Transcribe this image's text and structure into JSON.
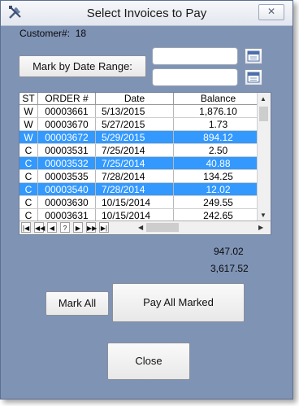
{
  "window": {
    "title": "Select Invoices to Pay",
    "close_glyph": "✕",
    "icon": "tools-icon"
  },
  "customer": {
    "label": "Customer#:",
    "number": "18"
  },
  "date_range": {
    "button_label": "Mark by Date Range:",
    "from_value": "",
    "to_value": "",
    "calendar_icon": "calendar-icon"
  },
  "grid": {
    "headers": [
      "ST",
      "ORDER #",
      "Date",
      "Balance"
    ],
    "rows": [
      {
        "st": "W",
        "order": "00003661",
        "date": "5/13/2015",
        "balance": "1,876.10",
        "selected": false
      },
      {
        "st": "W",
        "order": "00003670",
        "date": "5/27/2015",
        "balance": "1.73",
        "selected": false
      },
      {
        "st": "W",
        "order": "00003672",
        "date": "5/29/2015",
        "balance": "894.12",
        "selected": true
      },
      {
        "st": "C",
        "order": "00003531",
        "date": "7/25/2014",
        "balance": "2.50",
        "selected": false
      },
      {
        "st": "C",
        "order": "00003532",
        "date": "7/25/2014",
        "balance": "40.88",
        "selected": true
      },
      {
        "st": "C",
        "order": "00003535",
        "date": "7/28/2014",
        "balance": "134.25",
        "selected": false
      },
      {
        "st": "C",
        "order": "00003540",
        "date": "7/28/2014",
        "balance": "12.02",
        "selected": true
      },
      {
        "st": "C",
        "order": "00003630",
        "date": "10/15/2014",
        "balance": "249.55",
        "selected": false
      },
      {
        "st": "C",
        "order": "00003631",
        "date": "10/15/2014",
        "balance": "242.65",
        "selected": false
      }
    ],
    "nav": [
      "|◀",
      "◀◀",
      "◀",
      "?",
      "▶",
      "▶▶",
      "▶|"
    ],
    "scroll_left": "◀",
    "scroll_right": "▶",
    "scroll_up": "▲",
    "scroll_down": "▼"
  },
  "totals": {
    "marked_total": "947.02",
    "balance_total": "3,617.52"
  },
  "buttons": {
    "mark_all": "Mark All",
    "pay_all_marked": "Pay All Marked",
    "close": "Close"
  },
  "colors": {
    "window_bg": "#7f93b5",
    "selection": "#3399ff"
  }
}
